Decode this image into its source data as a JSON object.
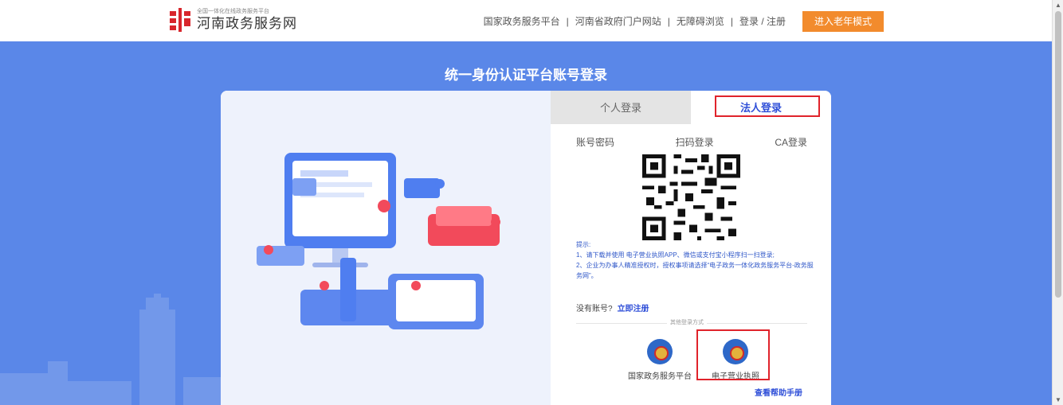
{
  "header": {
    "logo_subtitle": "全国一体化在线政务服务平台",
    "logo_title": "河南政务服务网",
    "nav": {
      "national": "国家政务服务平台",
      "portal": "河南省政府门户网站",
      "accessible": "无障碍浏览",
      "login_register": "登录 / 注册"
    },
    "elder_mode": "进入老年模式"
  },
  "page_title": "统一身份认证平台账号登录",
  "login": {
    "tabs": {
      "personal": "个人登录",
      "legal": "法人登录"
    },
    "subtabs": {
      "password": "账号密码",
      "scan": "扫码登录",
      "ca": "CA登录"
    },
    "tips": {
      "heading": "提示:",
      "line1": "1、请下载并使用 电子营业执照APP、微信或支付宝小程序扫一扫登录;",
      "line2": "2、企业为办事人精准授权时，授权事项请选择“电子政务一体化政务服务平台-政务服务网”。"
    },
    "no_account": "没有账号?",
    "register_link": "立即注册",
    "other_label": "其他登录方式",
    "other_gov": "国家政务服务平台",
    "other_license": "电子营业执照",
    "help_link": "查看帮助手册"
  },
  "colors": {
    "background": "#5a87e8",
    "accent": "#2f4fd8",
    "elder_button": "#f28b2d",
    "highlight": "#e0232b"
  }
}
